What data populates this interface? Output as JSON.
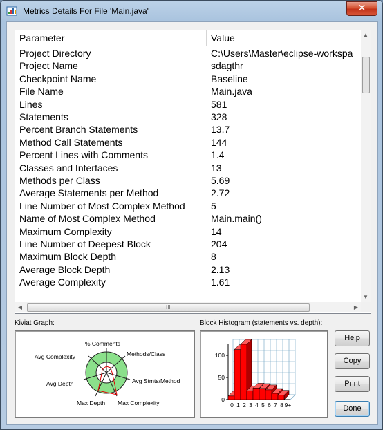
{
  "window": {
    "title": "Metrics Details For File 'Main.java'",
    "close_glyph": "✕"
  },
  "table": {
    "headers": {
      "parameter": "Parameter",
      "value": "Value"
    },
    "rows": [
      {
        "parameter": "Project Directory",
        "value": "C:\\Users\\Master\\eclipse-workspa"
      },
      {
        "parameter": "Project Name",
        "value": "sdagthr"
      },
      {
        "parameter": "Checkpoint Name",
        "value": "Baseline"
      },
      {
        "parameter": "File Name",
        "value": "Main.java"
      },
      {
        "parameter": "Lines",
        "value": "581"
      },
      {
        "parameter": "Statements",
        "value": "328"
      },
      {
        "parameter": "Percent Branch Statements",
        "value": "13.7"
      },
      {
        "parameter": "Method Call Statements",
        "value": "144"
      },
      {
        "parameter": "Percent Lines with Comments",
        "value": "1.4"
      },
      {
        "parameter": "Classes and Interfaces",
        "value": "13"
      },
      {
        "parameter": "Methods per Class",
        "value": "5.69"
      },
      {
        "parameter": "Average Statements per Method",
        "value": "2.72"
      },
      {
        "parameter": "Line Number of Most Complex Method",
        "value": "5"
      },
      {
        "parameter": "Name of Most Complex Method",
        "value": "Main.main()"
      },
      {
        "parameter": "Maximum Complexity",
        "value": "14"
      },
      {
        "parameter": "Line Number of Deepest Block",
        "value": "204"
      },
      {
        "parameter": "Maximum Block Depth",
        "value": "8"
      },
      {
        "parameter": "Average Block Depth",
        "value": "2.13"
      },
      {
        "parameter": "Average Complexity",
        "value": "1.61"
      }
    ],
    "scroll_grip": "III"
  },
  "kiviat": {
    "label": "Kiviat Graph:",
    "axes": {
      "comments": "% Comments",
      "methods_class": "Methods/Class",
      "avg_stmts": "Avg Stmts/Method",
      "max_complexity": "Max Complexity",
      "max_depth": "Max Depth",
      "avg_depth": "Avg Depth",
      "avg_complexity": "Avg Complexity"
    },
    "colors": {
      "ring": "#8be08b",
      "inner": "#ffffff",
      "data_line": "#e00000"
    }
  },
  "histogram": {
    "label": "Block Histogram (statements vs. depth):",
    "y_ticks": [
      "100",
      "50",
      "0"
    ],
    "x_ticks": [
      "0",
      "1",
      "2",
      "3",
      "4",
      "5",
      "6",
      "7",
      "8",
      "9+"
    ],
    "bar_color": "#ff0000"
  },
  "chart_data": {
    "type": "bar",
    "title": "Block Histogram (statements vs. depth):",
    "categories": [
      "0",
      "1",
      "2",
      "3",
      "4",
      "5",
      "6",
      "7",
      "8",
      "9+"
    ],
    "values": [
      8,
      113,
      125,
      20,
      26,
      25,
      22,
      14,
      10,
      0
    ],
    "ylim": [
      0,
      125
    ]
  },
  "buttons": {
    "help": "Help",
    "copy": "Copy",
    "print": "Print",
    "done": "Done"
  }
}
